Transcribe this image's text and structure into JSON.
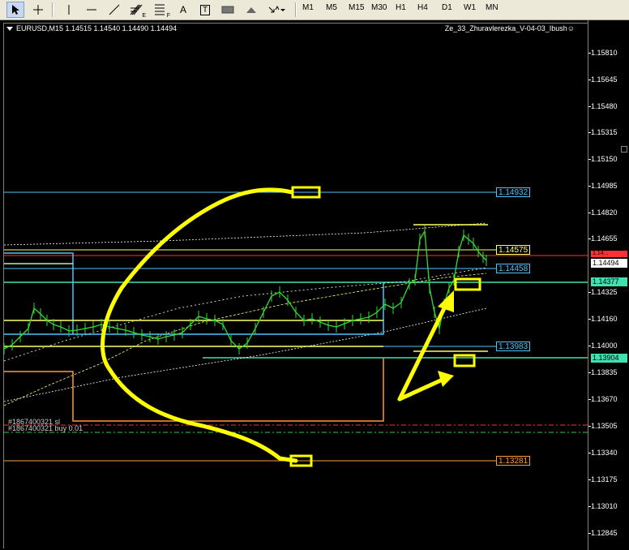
{
  "toolbar": {
    "tools": [
      {
        "name": "cursor-icon"
      },
      {
        "name": "crosshair-icon"
      },
      {
        "name": "vertical-line-icon"
      },
      {
        "name": "horizontal-line-icon"
      },
      {
        "name": "trendline-icon"
      },
      {
        "name": "fibonacci-icon"
      },
      {
        "name": "fibonacci-fan-icon"
      },
      {
        "name": "text-icon"
      },
      {
        "name": "text-label-icon"
      },
      {
        "name": "rectangle-icon"
      },
      {
        "name": "arrow-up-icon"
      },
      {
        "name": "arrows-dropdown-icon"
      }
    ],
    "text_label": "A",
    "label_t": "T",
    "fib_sub": "E",
    "fan_sub": "F",
    "timeframes": [
      "M1",
      "M5",
      "M15",
      "M30",
      "H1",
      "H4",
      "D1",
      "W1",
      "MN"
    ]
  },
  "chart": {
    "symbol_info": "EURUSD,M15  1.14515 1.14540 1.14490 1.14494",
    "indicator_name": "Ze_33_Zhuravlerezka_V-04-03_Ibush☺",
    "price_levels": [
      "1.15810",
      "1.15645",
      "1.15480",
      "1.15315",
      "1.15150",
      "1.14985",
      "1.14820",
      "1.14655",
      "1.14494",
      "1.14325",
      "1.14160",
      "1.14000",
      "1.13835",
      "1.13670",
      "1.13505",
      "1.13340",
      "1.13175",
      "1.13010",
      "1.12845"
    ],
    "current_price": "1.14494",
    "red_price": "1.14...",
    "level_labels": [
      {
        "text": "1.14932",
        "color": "#4fc3f7"
      },
      {
        "text": "1.14575",
        "color": "#ffff66"
      },
      {
        "text": "1.14458",
        "color": "#4fc3f7"
      },
      {
        "text": "1.13983",
        "color": "#4fc3f7"
      },
      {
        "text": "1.13281",
        "color": "#ff9933"
      }
    ],
    "axis_badges": [
      {
        "text": "1.14377",
        "bg": "#40e0b0"
      },
      {
        "text": "1.13904",
        "bg": "#40e0b0"
      }
    ],
    "orders": [
      "#1867400321 sl",
      "#1867400321 buy 0.01"
    ]
  }
}
